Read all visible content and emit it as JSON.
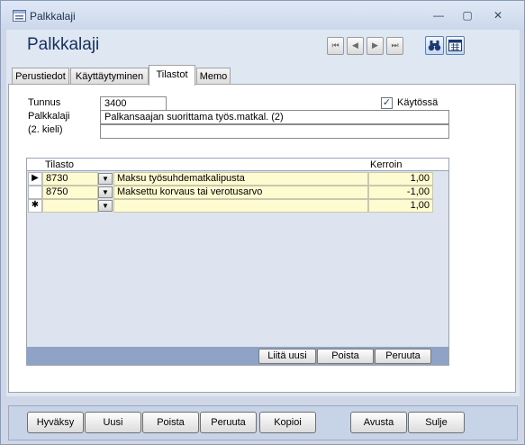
{
  "window": {
    "title": "Palkkalaji",
    "minimize": "—",
    "maximize": "▢",
    "close": "✕"
  },
  "form": {
    "title": "Palkkalaji"
  },
  "nav_buttons": [
    "⏮",
    "◀",
    "▶",
    "⏭"
  ],
  "tabs": [
    "Perustiedot",
    "Käyttäytyminen",
    "Tilastot",
    "Memo"
  ],
  "active_tab": "Tilastot",
  "fields": {
    "tunnus_label": "Tunnus",
    "tunnus_value": "3400",
    "palkkalaji_label": "Palkkalaji",
    "palkkalaji_value": "Palkansaajan suorittama työs.matkal. (2)",
    "kieli_label": "(2. kieli)",
    "kieli_value": "",
    "kaytossa_label": "Käytössä",
    "kaytossa_checked": "✓"
  },
  "grid": {
    "columns": [
      "Tilasto",
      "Kerroin"
    ],
    "rows": [
      {
        "selector": "▶",
        "code": "8730",
        "desc": "Maksu työsuhdematkalipusta",
        "kerroin": "1,00"
      },
      {
        "selector": "",
        "code": "8750",
        "desc": "Maksettu korvaus tai verotusarvo",
        "kerroin": "-1,00"
      },
      {
        "selector": "✱",
        "code": "",
        "desc": "",
        "kerroin": "1,00"
      }
    ],
    "buttons": [
      "Liitä uusi",
      "Poista",
      "Peruuta"
    ]
  },
  "footer_buttons": [
    "Hyväksy",
    "Uusi",
    "Poista",
    "Peruuta",
    "Kopioi",
    "Avusta",
    "Sulje"
  ]
}
